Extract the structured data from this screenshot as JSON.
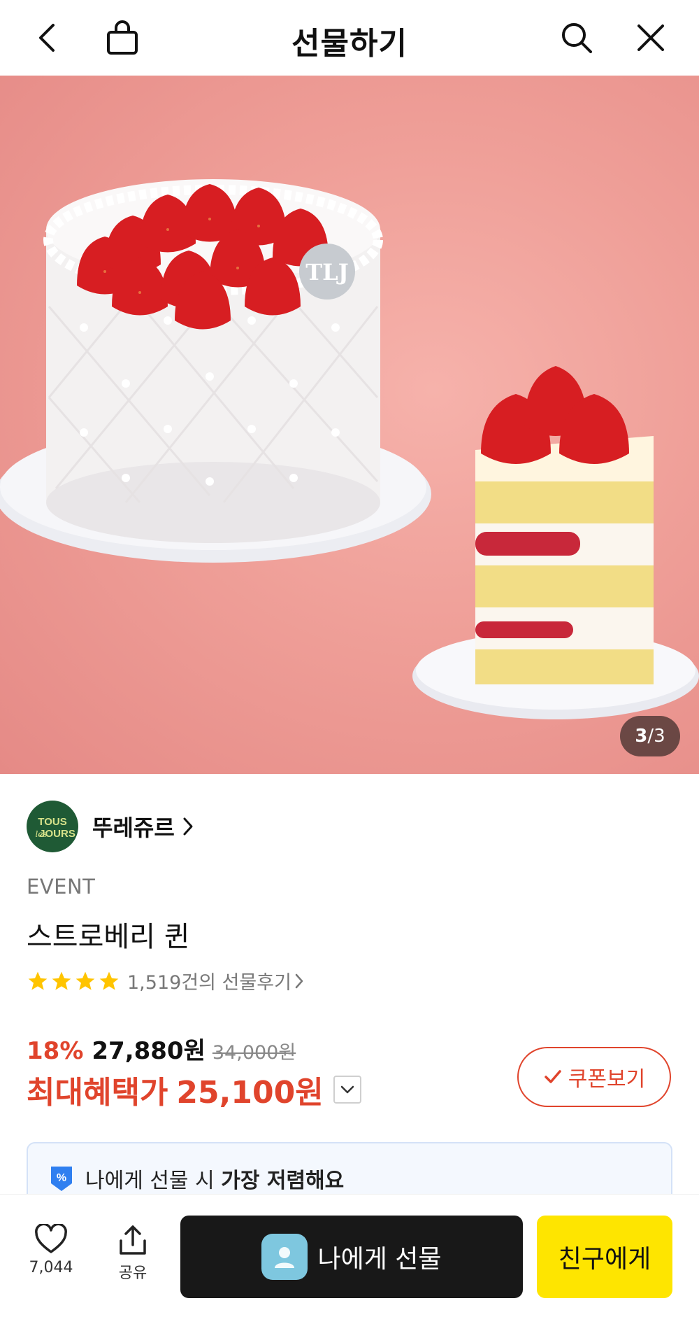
{
  "header": {
    "title": "선물하기",
    "icons": [
      "back-arrow-icon",
      "shopping-bag-icon",
      "search-icon",
      "close-icon"
    ]
  },
  "gallery": {
    "current": "3",
    "separator": "/",
    "total": "3",
    "logo_text": "TLJ"
  },
  "brand": {
    "name": "뚜레쥬르",
    "logo_top": "TOUS",
    "logo_bottom": "JOURS",
    "logo_script": "les",
    "color": "#1f5a35"
  },
  "product": {
    "event_label": "EVENT",
    "name": "스트로베리 퀸",
    "stars": 4,
    "review_text": "1,519건의 선물후기",
    "discount": "18%",
    "price": "27,880원",
    "original_price": "34,000원",
    "benefit_label": "최대혜택가",
    "benefit_price": "25,100원"
  },
  "coupon": {
    "label": "쿠폰보기"
  },
  "notice": {
    "prefix": "나에게 선물 시 ",
    "bold": "가장 저렴해요"
  },
  "bottom_bar": {
    "like_count": "7,044",
    "share_label": "공유",
    "self_gift_label": "나에게 선물",
    "friend_gift_label": "친구에게"
  },
  "colors": {
    "accent_red": "#e0442c",
    "kakao_yellow": "#fee500",
    "dark_button": "#181818",
    "star": "#ffc400"
  }
}
